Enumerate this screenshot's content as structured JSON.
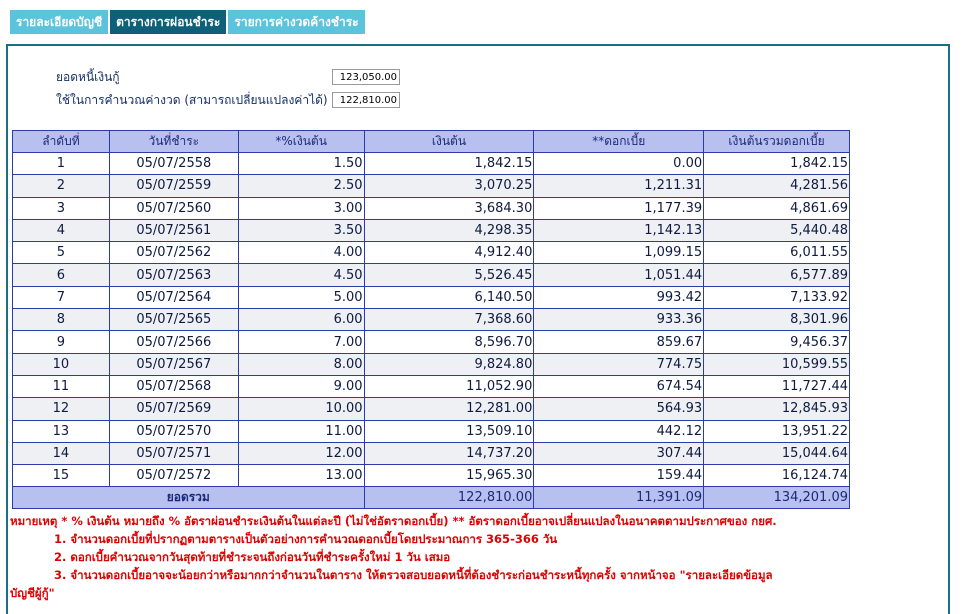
{
  "tabs": [
    {
      "label": "รายละเอียดบัญชี",
      "active": false
    },
    {
      "label": "ตารางการผ่อนชำระ",
      "active": true
    },
    {
      "label": "รายการค่างวดค้างชำระ",
      "active": false
    }
  ],
  "fields": {
    "debt_label": "ยอดหนี้เงินกู้",
    "debt_value": "123,050.00",
    "calc_label": "ใช้ในการคำนวณค่างวด (สามารถเปลี่ยนแปลงค่าได้)",
    "calc_value": "122,810.00"
  },
  "table": {
    "headers": [
      "ลำดับที่",
      "วันที่ชำระ",
      "*%เงินต้น",
      "เงินต้น",
      "**ดอกเบี้ย",
      "เงินต้นรวมดอกเบี้ย"
    ],
    "rows": [
      [
        "1",
        "05/07/2558",
        "1.50",
        "1,842.15",
        "0.00",
        "1,842.15"
      ],
      [
        "2",
        "05/07/2559",
        "2.50",
        "3,070.25",
        "1,211.31",
        "4,281.56"
      ],
      [
        "3",
        "05/07/2560",
        "3.00",
        "3,684.30",
        "1,177.39",
        "4,861.69"
      ],
      [
        "4",
        "05/07/2561",
        "3.50",
        "4,298.35",
        "1,142.13",
        "5,440.48"
      ],
      [
        "5",
        "05/07/2562",
        "4.00",
        "4,912.40",
        "1,099.15",
        "6,011.55"
      ],
      [
        "6",
        "05/07/2563",
        "4.50",
        "5,526.45",
        "1,051.44",
        "6,577.89"
      ],
      [
        "7",
        "05/07/2564",
        "5.00",
        "6,140.50",
        "993.42",
        "7,133.92"
      ],
      [
        "8",
        "05/07/2565",
        "6.00",
        "7,368.60",
        "933.36",
        "8,301.96"
      ],
      [
        "9",
        "05/07/2566",
        "7.00",
        "8,596.70",
        "859.67",
        "9,456.37"
      ],
      [
        "10",
        "05/07/2567",
        "8.00",
        "9,824.80",
        "774.75",
        "10,599.55"
      ],
      [
        "11",
        "05/07/2568",
        "9.00",
        "11,052.90",
        "674.54",
        "11,727.44"
      ],
      [
        "12",
        "05/07/2569",
        "10.00",
        "12,281.00",
        "564.93",
        "12,845.93"
      ],
      [
        "13",
        "05/07/2570",
        "11.00",
        "13,509.10",
        "442.12",
        "13,951.22"
      ],
      [
        "14",
        "05/07/2571",
        "12.00",
        "14,737.20",
        "307.44",
        "15,044.64"
      ],
      [
        "15",
        "05/07/2572",
        "13.00",
        "15,965.30",
        "159.44",
        "16,124.74"
      ]
    ],
    "total": {
      "label": "ยอดรวม",
      "principal": "122,810.00",
      "interest": "11,391.09",
      "sum": "134,201.09"
    }
  },
  "notes": {
    "main": "หมายเหตุ * % เงินต้น หมายถึง % อัตราผ่อนชำระเงินต้นในแต่ละปี (ไม่ใช่อัตราดอกเบี้ย) ** อัตราดอกเบี้ยอาจเปลี่ยนแปลงในอนาคตตามประกาศของ กยศ.",
    "items": [
      "1. จำนวนดอกเบี้ยที่ปรากฏตามตารางเป็นตัวอย่างการคำนวณดอกเบี้ยโดยประมาณการ 365-366 วัน",
      "2. ดอกเบี้ยคำนวณจากวันสุดท้ายที่ชำระจนถึงก่อนวันที่ชำระครั้งใหม่ 1 วัน เสมอ",
      "3. จำนวนดอกเบี้ยอาจจะน้อยกว่าหรือมากกว่าจำนวนในตาราง ให้ตรวจสอบยอดหนี้ที่ต้องชำระก่อนชำระหนี้ทุกครั้ง จากหน้าจอ \"รายละเอียดข้อมูล"
    ],
    "tail": "บัญชีผู้กู้\""
  },
  "colors": {
    "tab_inactive": "#5bc3dc",
    "tab_active": "#0d6078",
    "header_bg": "#b8c0f0",
    "border": "#2b3ba8",
    "note_red": "#e00000"
  }
}
